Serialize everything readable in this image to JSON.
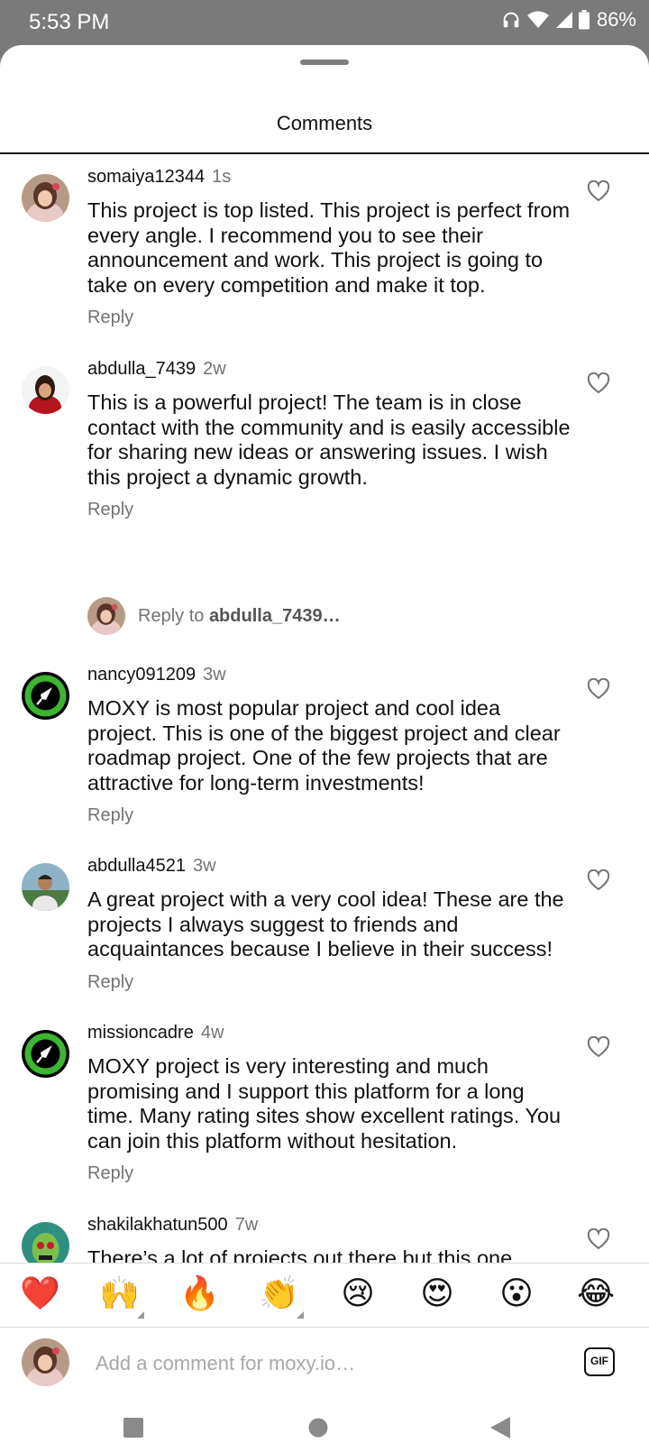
{
  "status_bar": {
    "time": "5:53 PM",
    "battery": "86%",
    "icons": [
      "headphones-icon",
      "wifi-icon",
      "signal-icon",
      "battery-icon"
    ]
  },
  "sheet": {
    "title": "Comments"
  },
  "comments": [
    {
      "username": "somaiya12344",
      "time": "1s",
      "text": "This project is top listed. This project is perfect from every angle. I recommend you to see their announcement and work. This project is going to take on every competition and make it top.",
      "reply_label": "Reply"
    },
    {
      "username": "abdulla_7439",
      "time": "2w",
      "text": "This is a powerful project! The team is in close contact with the community and is easily accessible for sharing new ideas or answering issues. I wish this project a dynamic growth.",
      "reply_label": "Reply"
    },
    {
      "username": "nancy091209",
      "time": "3w",
      "text": "MOXY is most popular project and cool idea project. This is one of the biggest project and clear roadmap project. One of the few projects that are attractive for long-term investments!",
      "reply_label": "Reply"
    },
    {
      "username": "abdulla4521",
      "time": "3w",
      "text": "A great project with a very cool idea! These are the projects I always suggest to friends and acquaintances because I believe in their success!",
      "reply_label": "Reply"
    },
    {
      "username": "missioncadre",
      "time": "4w",
      "text": "MOXY project is very interesting and much promising and I support this platform for a long time. Many rating sites show excellent ratings. You can join this platform without hesitation.",
      "reply_label": "Reply"
    },
    {
      "username": "shakilakhatun500",
      "time": "7w",
      "text": "There’s a lot of projects out there but this one",
      "reply_label": ""
    }
  ],
  "reply_prompt": {
    "prefix": "Reply to ",
    "target": "abdulla_7439…"
  },
  "emoji_bar": [
    "❤️",
    "🙌",
    "🔥",
    "👏",
    "😢",
    "😍",
    "😮",
    "😂"
  ],
  "input": {
    "placeholder": "Add a comment for moxy.io…",
    "gif_label": "GIF"
  },
  "colors": {
    "accent_heart": "#e0162b",
    "secondary_text": "#737373",
    "status_bar_bg": "#7a7a7a"
  }
}
